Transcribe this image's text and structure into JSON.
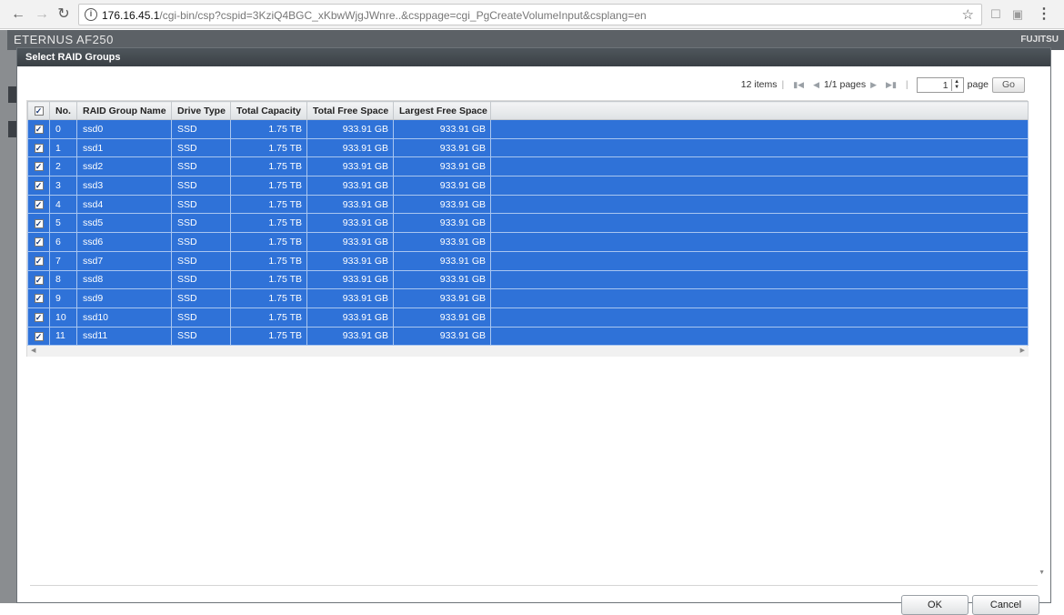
{
  "browser": {
    "url_host": "176.16.45.1",
    "url_path": "/cgi-bin/csp?cspid=3KziQ4BGC_xKbwWjgJWnre..&csppage=cgi_PgCreateVolumeInput&csplang=en"
  },
  "app": {
    "brand": "ETERNUS AF250",
    "logo": "FUJITSU"
  },
  "dialog": {
    "title": "Select RAID Groups",
    "pager": {
      "items": "12 items",
      "pages": "1/1 pages",
      "page_value": "1",
      "page_label": "page",
      "go_label": "Go"
    },
    "ok_label": "OK",
    "cancel_label": "Cancel"
  },
  "table": {
    "headers": [
      "No.",
      "RAID Group Name",
      "Drive Type",
      "Total Capacity",
      "Total Free Space",
      "Largest Free Space"
    ],
    "rows": [
      {
        "no": "0",
        "name": "ssd0",
        "type": "SSD",
        "capacity": "1.75 TB",
        "free": "933.91 GB",
        "largest": "933.91 GB"
      },
      {
        "no": "1",
        "name": "ssd1",
        "type": "SSD",
        "capacity": "1.75 TB",
        "free": "933.91 GB",
        "largest": "933.91 GB"
      },
      {
        "no": "2",
        "name": "ssd2",
        "type": "SSD",
        "capacity": "1.75 TB",
        "free": "933.91 GB",
        "largest": "933.91 GB"
      },
      {
        "no": "3",
        "name": "ssd3",
        "type": "SSD",
        "capacity": "1.75 TB",
        "free": "933.91 GB",
        "largest": "933.91 GB"
      },
      {
        "no": "4",
        "name": "ssd4",
        "type": "SSD",
        "capacity": "1.75 TB",
        "free": "933.91 GB",
        "largest": "933.91 GB"
      },
      {
        "no": "5",
        "name": "ssd5",
        "type": "SSD",
        "capacity": "1.75 TB",
        "free": "933.91 GB",
        "largest": "933.91 GB"
      },
      {
        "no": "6",
        "name": "ssd6",
        "type": "SSD",
        "capacity": "1.75 TB",
        "free": "933.91 GB",
        "largest": "933.91 GB"
      },
      {
        "no": "7",
        "name": "ssd7",
        "type": "SSD",
        "capacity": "1.75 TB",
        "free": "933.91 GB",
        "largest": "933.91 GB"
      },
      {
        "no": "8",
        "name": "ssd8",
        "type": "SSD",
        "capacity": "1.75 TB",
        "free": "933.91 GB",
        "largest": "933.91 GB"
      },
      {
        "no": "9",
        "name": "ssd9",
        "type": "SSD",
        "capacity": "1.75 TB",
        "free": "933.91 GB",
        "largest": "933.91 GB"
      },
      {
        "no": "10",
        "name": "ssd10",
        "type": "SSD",
        "capacity": "1.75 TB",
        "free": "933.91 GB",
        "largest": "933.91 GB"
      },
      {
        "no": "11",
        "name": "ssd11",
        "type": "SSD",
        "capacity": "1.75 TB",
        "free": "933.91 GB",
        "largest": "933.91 GB"
      }
    ]
  },
  "icons": {
    "back": "back-arrow-icon",
    "forward": "forward-arrow-icon",
    "reload": "reload-icon",
    "info": "info-icon",
    "bookmark": "star-icon",
    "menu": "kebab-menu-icon",
    "check": "checkbox-checked-icon"
  },
  "colors": {
    "selected_row": "#2f72d8",
    "title_bar": "#3a4045"
  }
}
